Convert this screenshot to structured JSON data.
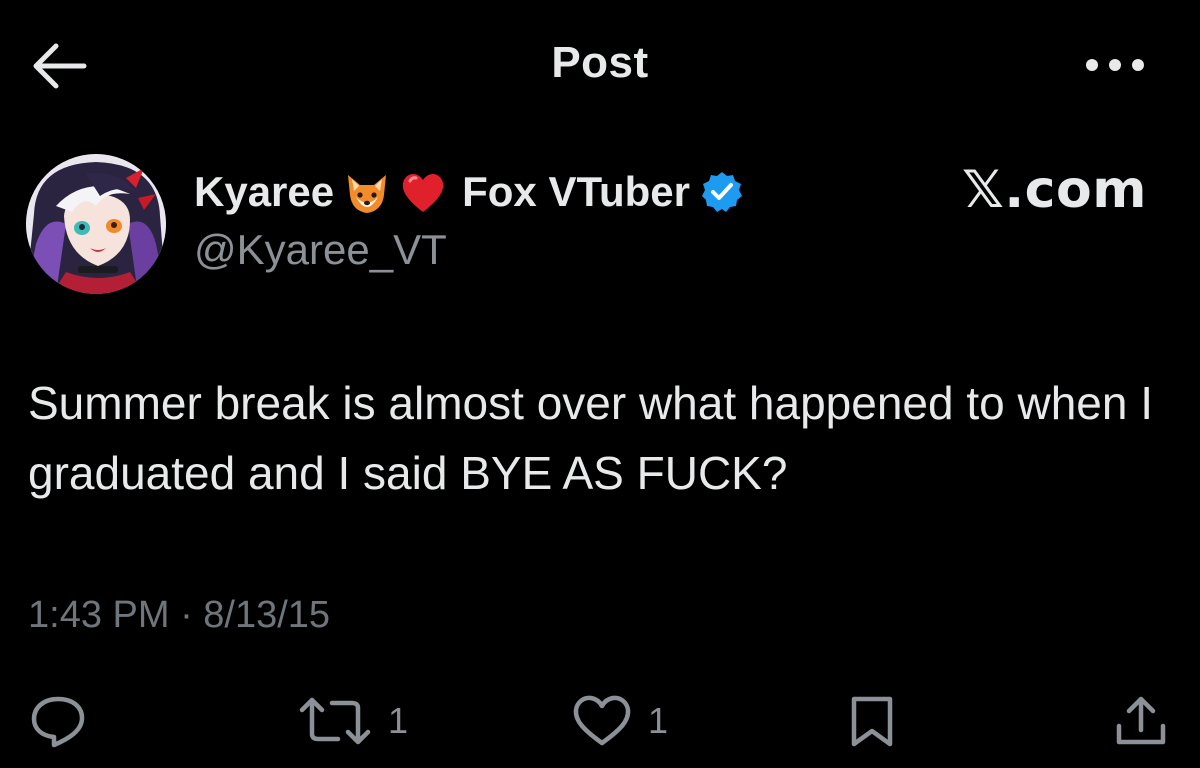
{
  "header": {
    "title": "Post",
    "back_icon": "arrow-left-icon",
    "more_icon": "more-horizontal-icon"
  },
  "author": {
    "name_first": "Kyaree",
    "name_emoji_1": "fox-face-emoji",
    "name_emoji_2": "red-heart-emoji",
    "name_last": "Fox VTuber",
    "verified": true,
    "handle": "@Kyaree_VT"
  },
  "watermark": "𝕏.com",
  "post": {
    "text": "Summer break is almost over what happened to when I graduated and I said BYE AS FUCK?",
    "timestamp": "1:43 PM · 8/13/15"
  },
  "actions": {
    "reply": {
      "icon": "reply-bubble-icon",
      "count": ""
    },
    "repost": {
      "icon": "repost-icon",
      "count": "1"
    },
    "like": {
      "icon": "heart-outline-icon",
      "count": "1"
    },
    "bookmark": {
      "icon": "bookmark-icon",
      "count": ""
    },
    "share": {
      "icon": "share-icon",
      "count": ""
    }
  },
  "colors": {
    "background": "#000000",
    "text": "#e7e9ea",
    "secondary_text": "#8b9196",
    "verified_blue": "#1d9bf0"
  }
}
